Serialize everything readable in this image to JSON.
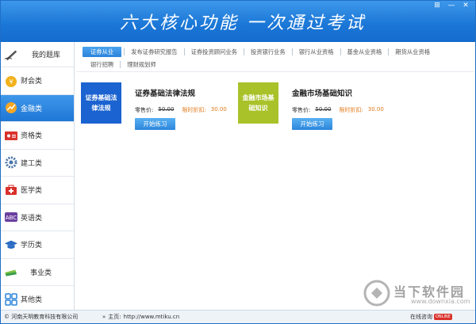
{
  "header": {
    "slogan": "六大核心功能  一次通过考试",
    "controls": [
      "⊞",
      "—",
      "✕"
    ]
  },
  "sidebar": {
    "items": [
      {
        "label": "我的题库",
        "icon": "pencil-icon",
        "active": false
      },
      {
        "label": "财会类",
        "icon": "coins-icon",
        "active": false
      },
      {
        "label": "金融类",
        "icon": "finance-chart-icon",
        "active": true
      },
      {
        "label": "资格类",
        "icon": "id-card-icon",
        "active": false
      },
      {
        "label": "建工类",
        "icon": "gear-icon",
        "active": false
      },
      {
        "label": "医学类",
        "icon": "medical-kit-icon",
        "active": false
      },
      {
        "label": "英语类",
        "icon": "english-badge-icon",
        "active": false
      },
      {
        "label": "学历类",
        "icon": "graduation-cap-icon",
        "active": false
      },
      {
        "label": "事业类",
        "icon": "books-icon",
        "active": false
      },
      {
        "label": "其他类",
        "icon": "grid-icon",
        "active": false
      }
    ]
  },
  "tabs": {
    "row1": [
      "证券从业",
      "发布证券研究报告",
      "证券投资顾问业务",
      "投资银行业务",
      "银行从业资格",
      "基金从业资格",
      "期货从业资格"
    ],
    "row2": [
      "银行招聘",
      "理财规划师"
    ],
    "active": "证券从业"
  },
  "courses": [
    {
      "cover_text": "证券基础法律法规",
      "cover_color": "#1b63d0",
      "title": "证券基础法律法规",
      "price_label": "零售价:",
      "price": "50.00",
      "discount_label": "限时折扣:",
      "discount_price": "30.00",
      "button": "开始练习"
    },
    {
      "cover_text": "金融市场基础知识",
      "cover_color": "#a9c22a",
      "title": "金融市场基础知识",
      "price_label": "零售价:",
      "price": "50.00",
      "discount_label": "限时折扣:",
      "discount_price": "30.00",
      "button": "开始练习"
    }
  ],
  "footer": {
    "copyright": "© 河南天明教育科技有限公司",
    "home_label": "主页:",
    "home_url": "http://www.mtiku.cn",
    "online_label": "在线咨询",
    "online_badge": "ONLINE"
  },
  "watermark": {
    "text": "当下软件园",
    "url": "www.downxia.com"
  },
  "colors": {
    "brand_blue": "#1a76d6",
    "discount_orange": "#e07a1c"
  }
}
